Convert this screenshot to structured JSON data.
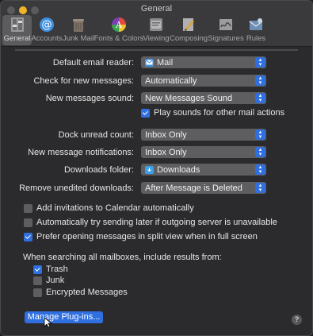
{
  "window": {
    "title": "General"
  },
  "toolbar": {
    "items": [
      {
        "label": "General",
        "icon": "general-switch-icon",
        "active": true
      },
      {
        "label": "Accounts",
        "icon": "at-sign-icon"
      },
      {
        "label": "Junk Mail",
        "icon": "trash-bin-icon"
      },
      {
        "label": "Fonts & Colors",
        "icon": "color-palette-icon"
      },
      {
        "label": "Viewing",
        "icon": "glasses-icon"
      },
      {
        "label": "Composing",
        "icon": "pencil-paper-icon"
      },
      {
        "label": "Signatures",
        "icon": "signature-icon"
      },
      {
        "label": "Rules",
        "icon": "rules-icon"
      }
    ]
  },
  "settings": {
    "default_reader": {
      "label": "Default email reader:",
      "value": "Mail"
    },
    "check_new": {
      "label": "Check for new messages:",
      "value": "Automatically"
    },
    "new_sound": {
      "label": "New messages sound:",
      "value": "New Messages Sound"
    },
    "play_sounds": {
      "label": "Play sounds for other mail actions",
      "checked": true
    },
    "dock_unread": {
      "label": "Dock unread count:",
      "value": "Inbox Only"
    },
    "notifications": {
      "label": "New message notifications:",
      "value": "Inbox Only"
    },
    "downloads_folder": {
      "label": "Downloads folder:",
      "value": "Downloads"
    },
    "remove_downloads": {
      "label": "Remove unedited downloads:",
      "value": "After Message is Deleted"
    }
  },
  "checks": {
    "add_calendar": {
      "label": "Add invitations to Calendar automatically",
      "checked": false
    },
    "auto_retry": {
      "label": "Automatically try sending later if outgoing server is unavailable",
      "checked": false
    },
    "split_view": {
      "label": "Prefer opening messages in split view when in full screen",
      "checked": true
    }
  },
  "search": {
    "label": "When searching all mailboxes, include results from:",
    "trash": {
      "label": "Trash",
      "checked": true
    },
    "junk": {
      "label": "Junk",
      "checked": false
    },
    "encrypted": {
      "label": "Encrypted Messages",
      "checked": false
    }
  },
  "buttons": {
    "manage_plugins": "Manage Plug-ins...",
    "help": "?"
  },
  "colors": {
    "accent": "#2f6fe0",
    "window_bg": "#2b2b2d",
    "titlebar": "#3a3a3c"
  }
}
